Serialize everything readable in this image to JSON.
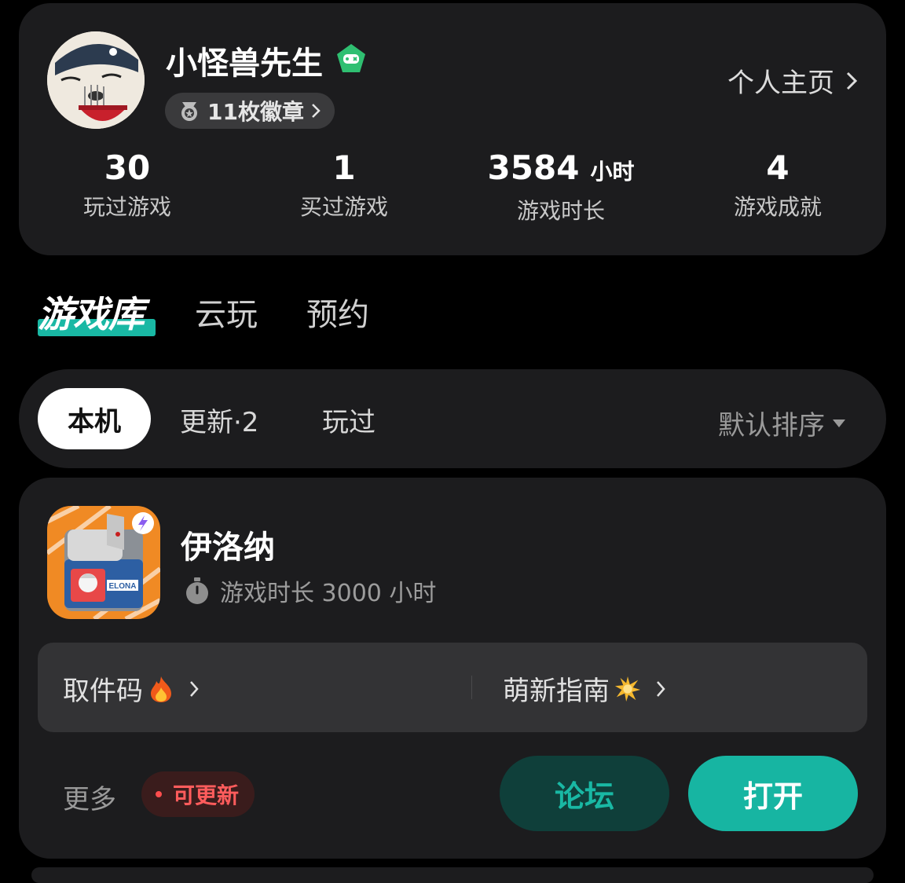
{
  "profile": {
    "username": "小怪兽先生",
    "badges_label": "11枚徽章",
    "homepage_label": "个人主页",
    "stats": [
      {
        "value": "30",
        "unit": "",
        "label": "玩过游戏"
      },
      {
        "value": "1",
        "unit": "",
        "label": "买过游戏"
      },
      {
        "value": "3584",
        "unit": "小时",
        "label": "游戏时长"
      },
      {
        "value": "4",
        "unit": "",
        "label": "游戏成就"
      }
    ]
  },
  "main_tabs": [
    {
      "label": "游戏库",
      "active": true
    },
    {
      "label": "云玩",
      "active": false
    },
    {
      "label": "预约",
      "active": false
    }
  ],
  "filters": {
    "options": [
      "本机",
      "更新·2",
      "玩过"
    ],
    "selected": "本机",
    "sort_label": "默认排序"
  },
  "game": {
    "title": "伊洛纳",
    "icon_text": "ELONA",
    "playtime": "游戏时长 3000 小时",
    "links": [
      {
        "label": "取件码",
        "emoji": "fire-icon"
      },
      {
        "label": "萌新指南",
        "emoji": "sparkle-icon"
      }
    ],
    "more_label": "更多",
    "update_badge": "可更新",
    "forum_button": "论坛",
    "open_button": "打开"
  },
  "colors": {
    "accent": "#19b8a4",
    "card_bg": "#1c1c1e",
    "update_red": "#ff5c5c"
  }
}
